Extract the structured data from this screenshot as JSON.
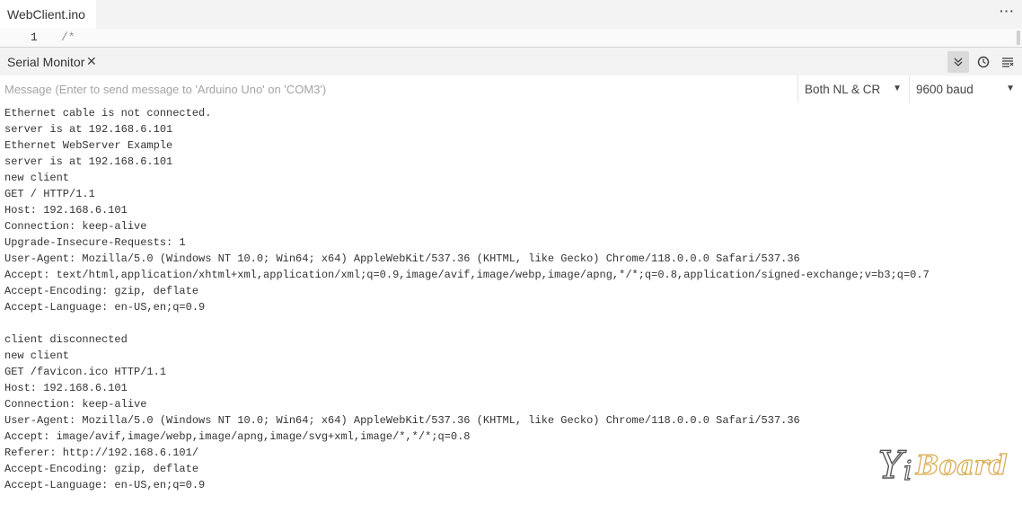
{
  "editor": {
    "tab_label": "WebClient.ino",
    "more_icon": "ellipsis-icon",
    "line_number": "1",
    "line_text": "/*"
  },
  "serial_monitor": {
    "title": "Serial Monitor",
    "close_icon": "close-icon",
    "toolbar_icons": [
      "autoscroll-icon",
      "timestamp-icon",
      "clear-output-icon"
    ],
    "message_placeholder": "Message (Enter to send message to 'Arduino Uno' on 'COM3')",
    "line_ending": "Both NL & CR",
    "baud_rate": "9600 baud",
    "output_lines": [
      "Ethernet cable is not connected.",
      "server is at 192.168.6.101",
      "Ethernet WebServer Example",
      "server is at 192.168.6.101",
      "new client",
      "GET / HTTP/1.1",
      "Host: 192.168.6.101",
      "Connection: keep-alive",
      "Upgrade-Insecure-Requests: 1",
      "User-Agent: Mozilla/5.0 (Windows NT 10.0; Win64; x64) AppleWebKit/537.36 (KHTML, like Gecko) Chrome/118.0.0.0 Safari/537.36",
      "Accept: text/html,application/xhtml+xml,application/xml;q=0.9,image/avif,image/webp,image/apng,*/*;q=0.8,application/signed-exchange;v=b3;q=0.7",
      "Accept-Encoding: gzip, deflate",
      "Accept-Language: en-US,en;q=0.9",
      "",
      "client disconnected",
      "new client",
      "GET /favicon.ico HTTP/1.1",
      "Host: 192.168.6.101",
      "Connection: keep-alive",
      "User-Agent: Mozilla/5.0 (Windows NT 10.0; Win64; x64) AppleWebKit/537.36 (KHTML, like Gecko) Chrome/118.0.0.0 Safari/537.36",
      "Accept: image/avif,image/webp,image/apng,image/svg+xml,image/*,*/*;q=0.8",
      "Referer: http://192.168.6.101/",
      "Accept-Encoding: gzip, deflate",
      "Accept-Language: en-US,en;q=0.9"
    ]
  },
  "watermark": {
    "text": "YiBoard"
  }
}
